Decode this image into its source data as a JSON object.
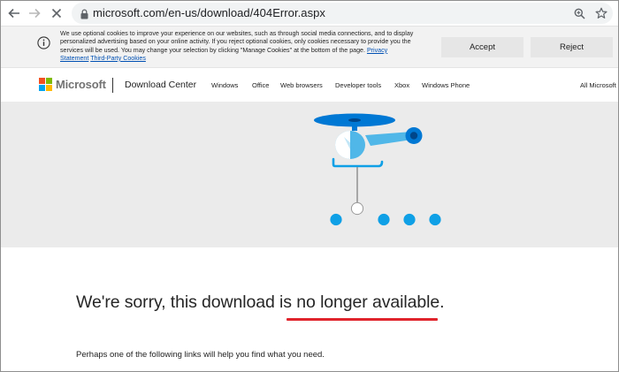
{
  "browser": {
    "url": "microsoft.com/en-us/download/404Error.aspx"
  },
  "cookie_banner": {
    "message": "We use optional cookies to improve your experience on our websites, such as through social media connections, and to display personalized advertising based on your online activity. If you reject optional cookies, only cookies necessary to provide you the services will be used. You may change your selection by clicking \"Manage Cookies\" at the bottom of the page.",
    "privacy_link": "Privacy Statement",
    "third_party_link": "Third-Party Cookies",
    "accept_label": "Accept",
    "reject_label": "Reject"
  },
  "header": {
    "brand": "Microsoft",
    "site_name": "Download Center",
    "nav": [
      "Windows",
      "Office",
      "Web browsers",
      "Developer tools",
      "Xbox",
      "Windows Phone"
    ],
    "all_microsoft": "All Microsoft"
  },
  "main": {
    "headline": "We're sorry, this download is no longer available.",
    "subtext": "Perhaps one of the following links will help you find what you need."
  },
  "colors": {
    "accent_blue": "#0078d4",
    "light_blue": "#50b7e8",
    "underline_red": "#e0242c",
    "logo_red": "#f25022",
    "logo_green": "#7fba00",
    "logo_blue": "#00a4ef",
    "logo_yellow": "#ffb900"
  }
}
